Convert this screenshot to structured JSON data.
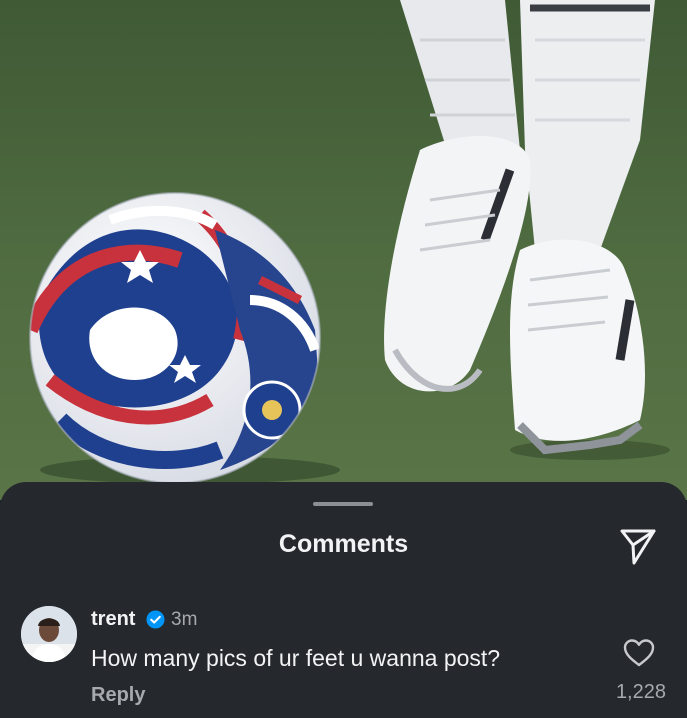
{
  "sheet": {
    "title": "Comments"
  },
  "comment": {
    "username": "trent",
    "verified": true,
    "time": "3m",
    "text": "How many pics of ur feet u wanna post?",
    "reply_label": "Reply",
    "like_count": "1,228"
  },
  "colors": {
    "sheet_bg": "#25282d",
    "text_primary": "#f2f3f5",
    "text_secondary": "#a6a9ad",
    "verified_blue": "#0095f6"
  },
  "icons": [
    "paper-plane-icon",
    "verified-badge-icon",
    "heart-icon"
  ]
}
